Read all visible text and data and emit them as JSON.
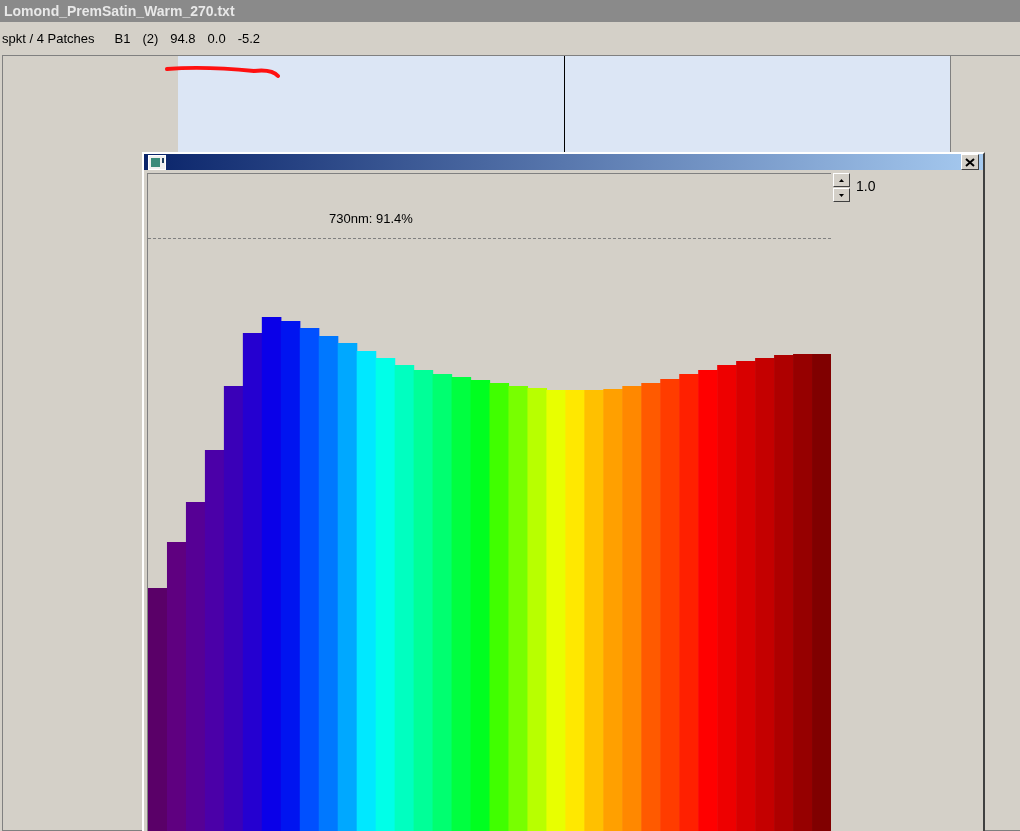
{
  "window": {
    "title": "Lomond_PremSatin_Warm_270.txt"
  },
  "status_fields": [
    "spkt / 4 Patches",
    "B1",
    "(2)",
    "94.8",
    "0.0",
    "-5.2"
  ],
  "spectrum_window": {
    "readout": "730nm: 91.4%",
    "scale_value": "1.0"
  }
}
